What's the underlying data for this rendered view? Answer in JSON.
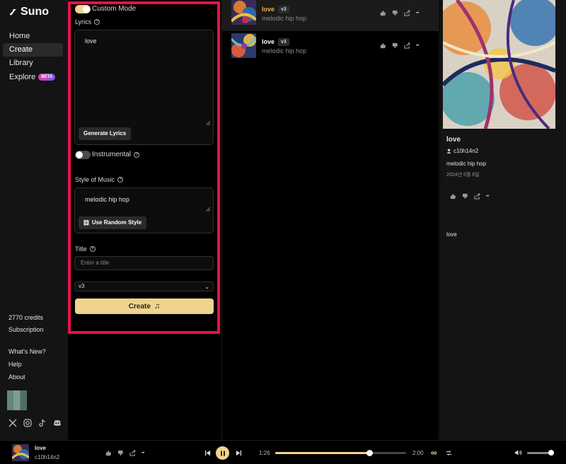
{
  "app": {
    "name": "Suno"
  },
  "sidebar": {
    "items": [
      {
        "label": "Home"
      },
      {
        "label": "Create"
      },
      {
        "label": "Library"
      },
      {
        "label": "Explore",
        "badge": "BETA"
      }
    ],
    "credits": "2770 credits",
    "subscription": "Subscription",
    "whats_new": "What's New?",
    "help": "Help",
    "about": "About"
  },
  "form": {
    "custom_mode_label": "Custom Mode",
    "lyrics_label": "Lyrics",
    "lyrics_value": "love",
    "generate_lyrics": "Generate Lyrics",
    "instrumental_label": "Instrumental",
    "style_label": "Style of Music",
    "style_value": "melodic hip hop",
    "random_style": "Use Random Style",
    "title_label": "Title",
    "title_placeholder": "Enter a title",
    "version_value": "v3",
    "create_label": "Create",
    "help_glyph": "?",
    "chevron_glyph": "⌄",
    "music_glyph": "♫",
    "dice_glyph": "⚄"
  },
  "songs": [
    {
      "title": "love",
      "version": "v3",
      "style": "melodic hip hop"
    },
    {
      "title": "love",
      "version": "v3",
      "style": "melodic hip hop"
    }
  ],
  "detail": {
    "title": "love",
    "artist": "c10h14n2",
    "style": "melodic hip hop",
    "date": "2024년 5월 6일",
    "lyrics": "love",
    "more_glyph": "•••"
  },
  "player": {
    "title": "love",
    "artist": "c10h14n2",
    "elapsed": "1:26",
    "duration": "2:00",
    "progress": 0.72,
    "volume": 1.0,
    "loop_glyph": "∞"
  },
  "colors": {
    "accent": "#f0d48c",
    "highlight": "#e8104a",
    "beta_from": "#e0409a",
    "beta_to": "#7c5bf0"
  }
}
